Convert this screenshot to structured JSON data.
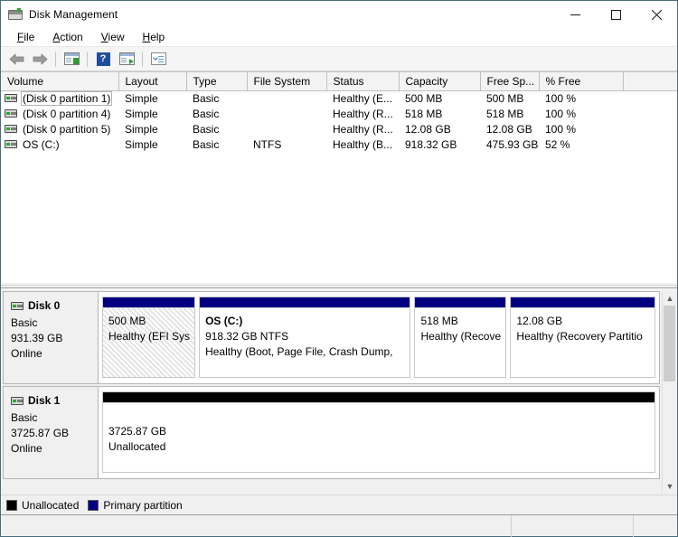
{
  "window": {
    "title": "Disk Management",
    "icon": "disk-drive-icon",
    "controls": {
      "minimize": "minimize-icon",
      "maximize": "maximize-icon",
      "close": "close-icon"
    }
  },
  "menubar": {
    "items": [
      {
        "label": "File",
        "accel": "F"
      },
      {
        "label": "Action",
        "accel": "A"
      },
      {
        "label": "View",
        "accel": "V"
      },
      {
        "label": "Help",
        "accel": "H"
      }
    ]
  },
  "toolbar": {
    "buttons": [
      {
        "name": "back-arrow-icon",
        "type": "arrow-left"
      },
      {
        "name": "forward-arrow-icon",
        "type": "arrow-right"
      },
      {
        "name": "show-hide-console-tree-icon",
        "type": "window-green-bar"
      },
      {
        "name": "help-icon",
        "type": "help",
        "glyph": "?"
      },
      {
        "name": "show-hide-action-pane-icon",
        "type": "window-play"
      },
      {
        "name": "properties-icon",
        "type": "properties"
      }
    ]
  },
  "volume_list": {
    "columns": [
      {
        "key": "volume",
        "label": "Volume"
      },
      {
        "key": "layout",
        "label": "Layout"
      },
      {
        "key": "type",
        "label": "Type"
      },
      {
        "key": "file_system",
        "label": "File System"
      },
      {
        "key": "status",
        "label": "Status"
      },
      {
        "key": "capacity",
        "label": "Capacity"
      },
      {
        "key": "free_space",
        "label": "Free Sp..."
      },
      {
        "key": "percent_free",
        "label": "% Free"
      },
      {
        "key": "spare",
        "label": ""
      }
    ],
    "rows": [
      {
        "volume": "(Disk 0 partition 1)",
        "layout": "Simple",
        "type": "Basic",
        "file_system": "",
        "status": "Healthy (E...",
        "capacity": "500 MB",
        "free_space": "500 MB",
        "percent_free": "100 %",
        "focused": true
      },
      {
        "volume": "(Disk 0 partition 4)",
        "layout": "Simple",
        "type": "Basic",
        "file_system": "",
        "status": "Healthy (R...",
        "capacity": "518 MB",
        "free_space": "518 MB",
        "percent_free": "100 %",
        "focused": false
      },
      {
        "volume": "(Disk 0 partition 5)",
        "layout": "Simple",
        "type": "Basic",
        "file_system": "",
        "status": "Healthy (R...",
        "capacity": "12.08 GB",
        "free_space": "12.08 GB",
        "percent_free": "100 %",
        "focused": false
      },
      {
        "volume": "OS (C:)",
        "layout": "Simple",
        "type": "Basic",
        "file_system": "NTFS",
        "status": "Healthy (B...",
        "capacity": "918.32 GB",
        "free_space": "475.93 GB",
        "percent_free": "52 %",
        "focused": false
      }
    ]
  },
  "disks": [
    {
      "name": "Disk 0",
      "type": "Basic",
      "size": "931.39 GB",
      "state": "Online",
      "partitions": [
        {
          "title": "",
          "size_line": "500 MB",
          "status_line": "Healthy (EFI Sys",
          "bar": "primary",
          "hatched": true,
          "flex": 95
        },
        {
          "title": "OS  (C:)",
          "size_line": "918.32 GB NTFS",
          "status_line": "Healthy (Boot, Page File, Crash Dump,",
          "bar": "primary",
          "hatched": false,
          "flex": 216
        },
        {
          "title": "",
          "size_line": "518 MB",
          "status_line": "Healthy (Recove",
          "bar": "primary",
          "hatched": false,
          "flex": 94
        },
        {
          "title": "",
          "size_line": "12.08 GB",
          "status_line": "Healthy (Recovery Partitio",
          "bar": "primary",
          "hatched": false,
          "flex": 148
        }
      ]
    },
    {
      "name": "Disk 1",
      "type": "Basic",
      "size": "3725.87 GB",
      "state": "Online",
      "partitions": [
        {
          "title": "",
          "size_line": "3725.87 GB",
          "status_line": "Unallocated",
          "bar": "unalloc",
          "hatched": false,
          "flex": 600
        }
      ]
    }
  ],
  "legend": {
    "items": [
      {
        "label": "Unallocated",
        "swatch": "black",
        "color": "#000000"
      },
      {
        "label": "Primary partition",
        "swatch": "navy",
        "color": "#000080"
      }
    ]
  },
  "scrollbar": {
    "up_arrow": "scroll-up-icon",
    "down_arrow": "scroll-down-icon"
  },
  "statusbar": {
    "segments": [
      "",
      "",
      ""
    ]
  },
  "colors": {
    "primary_partition": "#000080",
    "unallocated": "#000000",
    "window_chrome": "#f0f0f0",
    "border": "#4a6d7c"
  }
}
